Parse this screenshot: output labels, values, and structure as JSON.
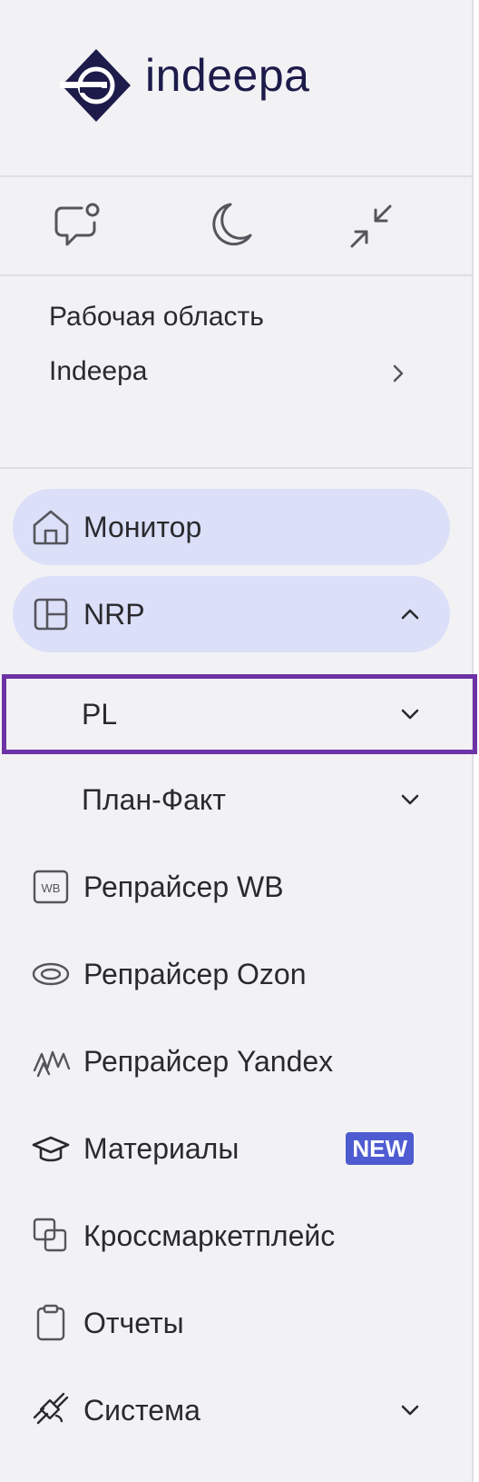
{
  "logo": {
    "text": "indeepa",
    "color": "#1c1b4a"
  },
  "actions": [
    {
      "name": "support-chat",
      "icon": "chat-icon"
    },
    {
      "name": "theme-toggle",
      "icon": "moon-icon"
    },
    {
      "name": "collapse-sidebar",
      "icon": "collapse-icon"
    }
  ],
  "workspace": {
    "caption": "Рабочая область",
    "name": "Indeepa"
  },
  "nav": {
    "monitor": {
      "label": "Монитор",
      "icon": "home-icon"
    },
    "nrp": {
      "label": "NRP",
      "icon": "layout-icon"
    },
    "pl": {
      "label": "PL"
    },
    "plan_fact": {
      "label": "План-Факт"
    },
    "repricer_wb": {
      "label": "Репрайсер WB",
      "icon": "wb-icon"
    },
    "repricer_ozon": {
      "label": "Репрайсер Ozon",
      "icon": "ozon-icon"
    },
    "repricer_yandex": {
      "label": "Репрайсер Yandex",
      "icon": "yandex-icon"
    },
    "materials": {
      "label": "Материалы",
      "icon": "graduation-cap-icon",
      "badge": "NEW"
    },
    "crossmarket": {
      "label": "Кроссмаркетплейс",
      "icon": "overlap-squares-icon"
    },
    "reports": {
      "label": "Отчеты",
      "icon": "clipboard-icon"
    },
    "system": {
      "label": "Система",
      "icon": "satellite-icon"
    }
  },
  "colors": {
    "sidebar_bg": "#f2f2f5",
    "active_bg": "#dbdff8",
    "badge_bg": "#4e5bd1",
    "highlight_border": "#6d32a6",
    "text": "#2a2a2e"
  }
}
